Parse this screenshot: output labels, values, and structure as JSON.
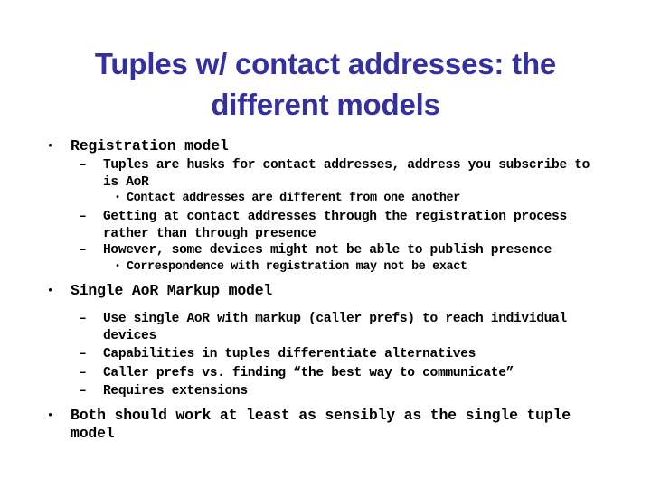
{
  "slide": {
    "title": "Tuples w/ contact addresses: the different models",
    "title_lines": [
      "Tuples w/ contact addresses: the",
      "different models"
    ],
    "title_color": "#3330a0",
    "body_color": "#000000",
    "background_color": "#ffffff",
    "markers": {
      "level1": "•",
      "level2": "–",
      "level3": "•"
    },
    "content": [
      {
        "level": 1,
        "marker": "•",
        "text": "Registration model"
      },
      {
        "level": 2,
        "marker": "–",
        "text": "Tuples are husks for contact addresses, address you subscribe to is AoR"
      },
      {
        "level": 3,
        "marker": "•",
        "text": "Contact addresses are different from one another"
      },
      {
        "level": 2,
        "marker": "–",
        "text": "Getting at contact addresses through the registration process rather than through presence"
      },
      {
        "level": 2,
        "marker": "–",
        "text": "However, some devices might not be able to publish presence"
      },
      {
        "level": 3,
        "marker": "•",
        "text": "Correspondence with registration may not be exact"
      },
      {
        "level": 1,
        "marker": "•",
        "text": "Single AoR Markup model"
      },
      {
        "level": 2,
        "marker": "–",
        "text": "Use single AoR with markup (caller prefs) to reach individual devices"
      },
      {
        "level": 2,
        "marker": "–",
        "text": "Capabilities in tuples differentiate alternatives"
      },
      {
        "level": 2,
        "marker": "–",
        "text": "Caller prefs vs. finding “the best way to communicate”"
      },
      {
        "level": 2,
        "marker": "–",
        "text": "Requires extensions"
      },
      {
        "level": 1,
        "marker": "•",
        "text": "Both should work at least as sensibly as the single tuple model"
      }
    ]
  }
}
